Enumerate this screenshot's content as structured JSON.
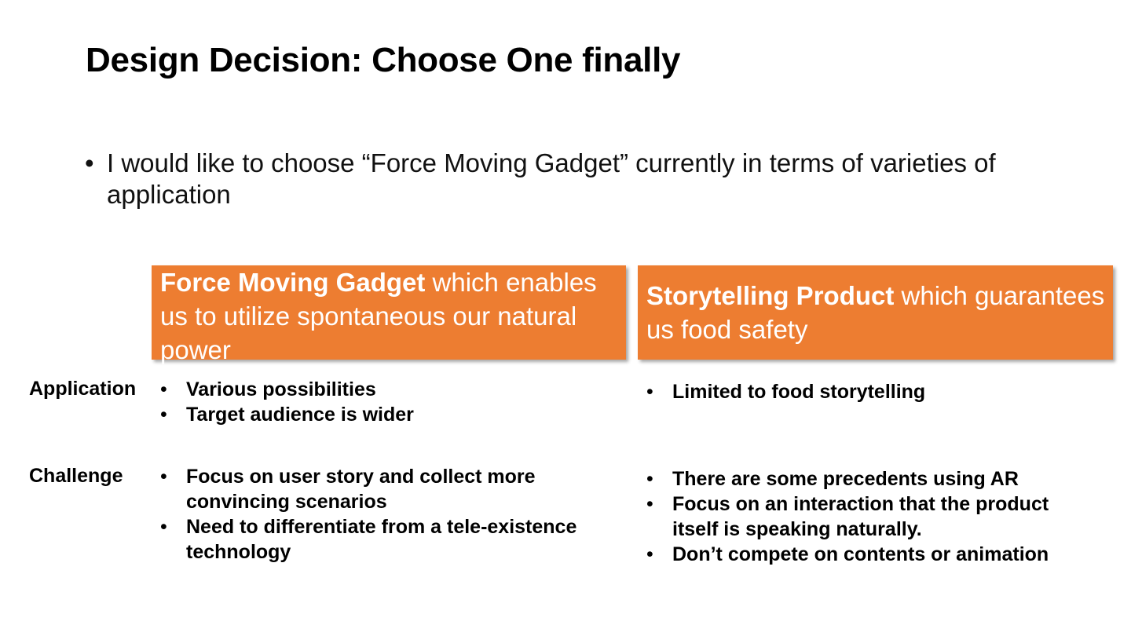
{
  "slide": {
    "title": "Design Decision: Choose One finally",
    "intro": {
      "bullet": "•",
      "text": "I would like to choose “Force Moving Gadget” currently in terms of varieties of application"
    },
    "options": [
      {
        "name": "Force Moving Gadget",
        "description": " which enables us to utilize spontaneous our natural power"
      },
      {
        "name": "Storytelling Product",
        "description": " which guarantees us food safety"
      }
    ],
    "rows": [
      {
        "label": "Application",
        "option_a": [
          "Various possibilities",
          "Target audience is wider"
        ],
        "option_b": [
          "Limited to food storytelling"
        ]
      },
      {
        "label": "Challenge",
        "option_a": [
          "Focus on user story and collect more convincing scenarios",
          "Need to differentiate from a tele-existence technology"
        ],
        "option_b": [
          "There are some precedents using AR",
          "Focus on an interaction that the product itself is speaking naturally.",
          "Don’t compete on contents or animation"
        ]
      }
    ],
    "bullet_glyph": "•",
    "colors": {
      "box_fill": "#ed7d31",
      "box_text": "#ffffff",
      "text": "#000000",
      "background": "#ffffff"
    }
  }
}
